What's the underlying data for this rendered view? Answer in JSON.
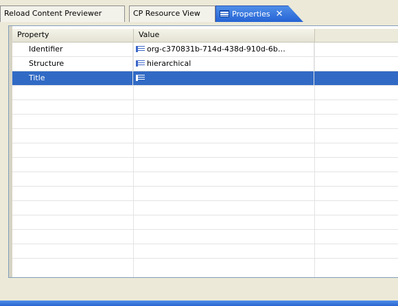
{
  "tabs": [
    {
      "label": "Reload Content Previewer",
      "active": false
    },
    {
      "label": "CP Resource View",
      "active": false
    },
    {
      "label": "Properties",
      "active": true,
      "icon": "properties-icon",
      "close": "✕"
    }
  ],
  "table": {
    "columns": [
      "Property",
      "Value"
    ],
    "rows": [
      {
        "property": "Identifier",
        "value": "org-c370831b-714d-438d-910d-6b…",
        "selected": false
      },
      {
        "property": "Structure",
        "value": "hierarchical",
        "selected": false
      },
      {
        "property": "Title",
        "value": "",
        "selected": true
      }
    ]
  },
  "colors": {
    "selection": "#316ac5",
    "active_tab": "#2563d4",
    "background": "#ece9d8"
  }
}
